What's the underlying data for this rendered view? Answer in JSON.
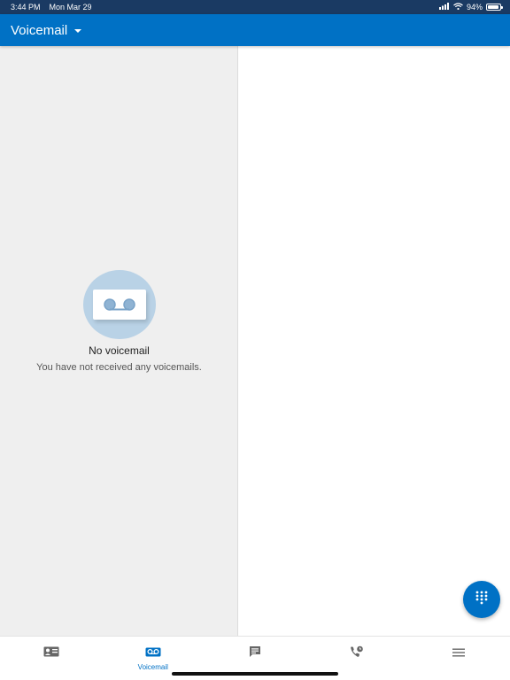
{
  "status_bar": {
    "time": "3:44 PM",
    "date": "Mon Mar 29",
    "battery_percent": "94%",
    "battery_level": 0.94,
    "signal_icon": "cellular-signal-icon",
    "wifi_icon": "wifi-icon",
    "battery_icon": "battery-icon"
  },
  "app_bar": {
    "title": "Voicemail",
    "dropdown_icon": "caret-down-icon",
    "background": "#0071c5"
  },
  "empty_state": {
    "icon": "voicemail-icon",
    "title": "No voicemail",
    "message": "You have not received any voicemails."
  },
  "fab": {
    "icon": "dialpad-icon"
  },
  "bottom_nav": {
    "items": [
      {
        "id": "contacts",
        "icon": "contact-card-icon",
        "label": "",
        "selected": false
      },
      {
        "id": "voicemail",
        "icon": "voicemail-icon",
        "label": "Voicemail",
        "selected": true
      },
      {
        "id": "messages",
        "icon": "message-icon",
        "label": "",
        "selected": false
      },
      {
        "id": "recents",
        "icon": "call-history-icon",
        "label": "",
        "selected": false
      },
      {
        "id": "menu",
        "icon": "hamburger-menu-icon",
        "label": "",
        "selected": false
      }
    ]
  },
  "colors": {
    "accent": "#0071c5",
    "status_bar": "#1a3a63",
    "icon_gray": "#666666",
    "empty_circle": "#b9d2e6"
  }
}
